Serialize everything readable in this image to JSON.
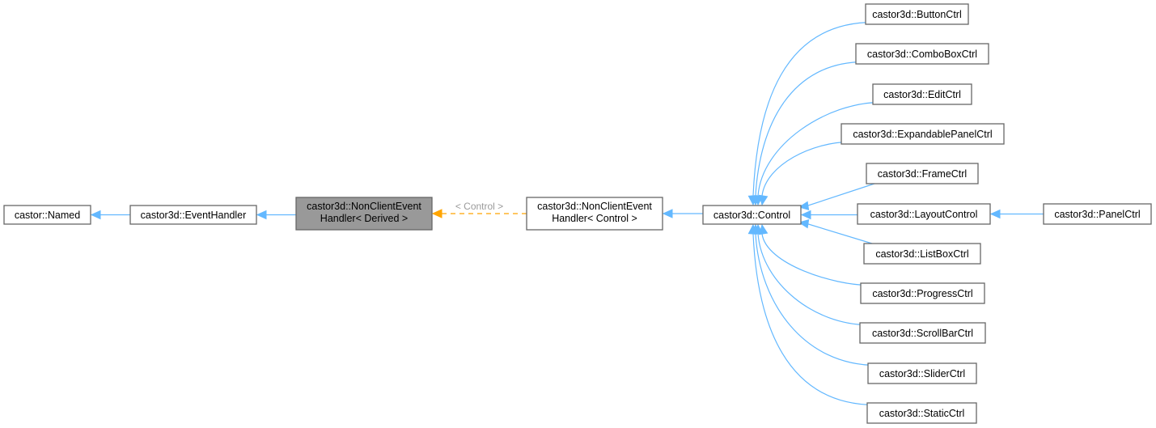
{
  "diagram": {
    "type": "class-inheritance-graph",
    "colors": {
      "edge": "#63b8ff",
      "template_edge": "#ffa500",
      "focus_fill": "#999999",
      "node_border": "#666666",
      "label_gray": "#9a9a9a"
    },
    "nodes": {
      "named": {
        "lines": [
          "castor::Named"
        ]
      },
      "event_handler": {
        "lines": [
          "castor3d::EventHandler"
        ]
      },
      "nonclient_derived": {
        "lines": [
          "castor3d::NonClientEvent",
          "Handler< Derived >"
        ],
        "focus": true
      },
      "nonclient_control": {
        "lines": [
          "castor3d::NonClientEvent",
          "Handler< Control >"
        ]
      },
      "control": {
        "lines": [
          "castor3d::Control"
        ]
      },
      "button": {
        "lines": [
          "castor3d::ButtonCtrl"
        ]
      },
      "combobox": {
        "lines": [
          "castor3d::ComboBoxCtrl"
        ]
      },
      "edit": {
        "lines": [
          "castor3d::EditCtrl"
        ]
      },
      "expandable": {
        "lines": [
          "castor3d::ExpandablePanelCtrl"
        ]
      },
      "frame": {
        "lines": [
          "castor3d::FrameCtrl"
        ]
      },
      "layout": {
        "lines": [
          "castor3d::LayoutControl"
        ]
      },
      "panel": {
        "lines": [
          "castor3d::PanelCtrl"
        ]
      },
      "listbox": {
        "lines": [
          "castor3d::ListBoxCtrl"
        ]
      },
      "progress": {
        "lines": [
          "castor3d::ProgressCtrl"
        ]
      },
      "scrollbar": {
        "lines": [
          "castor3d::ScrollBarCtrl"
        ]
      },
      "slider": {
        "lines": [
          "castor3d::SliderCtrl"
        ]
      },
      "static": {
        "lines": [
          "castor3d::StaticCtrl"
        ]
      }
    },
    "edges": [
      {
        "from": "event_handler",
        "to": "named",
        "kind": "inherit"
      },
      {
        "from": "nonclient_derived",
        "to": "event_handler",
        "kind": "inherit"
      },
      {
        "from": "nonclient_control",
        "to": "nonclient_derived",
        "kind": "template",
        "label": "< Control >"
      },
      {
        "from": "control",
        "to": "nonclient_control",
        "kind": "inherit"
      },
      {
        "from": "button",
        "to": "control",
        "kind": "inherit"
      },
      {
        "from": "combobox",
        "to": "control",
        "kind": "inherit"
      },
      {
        "from": "edit",
        "to": "control",
        "kind": "inherit"
      },
      {
        "from": "expandable",
        "to": "control",
        "kind": "inherit"
      },
      {
        "from": "frame",
        "to": "control",
        "kind": "inherit"
      },
      {
        "from": "layout",
        "to": "control",
        "kind": "inherit"
      },
      {
        "from": "panel",
        "to": "layout",
        "kind": "inherit"
      },
      {
        "from": "listbox",
        "to": "control",
        "kind": "inherit"
      },
      {
        "from": "progress",
        "to": "control",
        "kind": "inherit"
      },
      {
        "from": "scrollbar",
        "to": "control",
        "kind": "inherit"
      },
      {
        "from": "slider",
        "to": "control",
        "kind": "inherit"
      },
      {
        "from": "static",
        "to": "control",
        "kind": "inherit"
      }
    ]
  }
}
